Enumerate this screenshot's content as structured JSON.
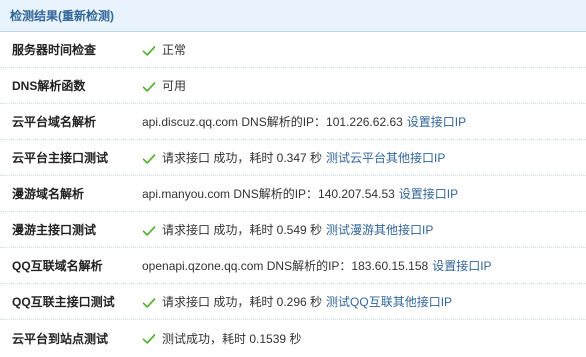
{
  "header": {
    "title": "检测结果(重新检测)"
  },
  "colors": {
    "accent": "#336699",
    "check": "#4caf2a",
    "header_bg": "#e8f3fd"
  },
  "rows": [
    {
      "label": "服务器时间检查",
      "check": true,
      "text": "正常",
      "link": ""
    },
    {
      "label": "DNS解析函数",
      "check": true,
      "text": "可用",
      "link": ""
    },
    {
      "label": "云平台域名解析",
      "check": false,
      "text": "api.discuz.qq.com DNS解析的IP：101.226.62.63",
      "link": "设置接口IP"
    },
    {
      "label": "云平台主接口测试",
      "check": true,
      "text": "请求接口 成功，耗时 0.347 秒",
      "link": "测试云平台其他接口IP"
    },
    {
      "label": "漫游域名解析",
      "check": false,
      "text": "api.manyou.com DNS解析的IP：140.207.54.53",
      "link": "设置接口IP"
    },
    {
      "label": "漫游主接口测试",
      "check": true,
      "text": "请求接口 成功，耗时 0.549 秒",
      "link": "测试漫游其他接口IP"
    },
    {
      "label": "QQ互联域名解析",
      "check": false,
      "text": "openapi.qzone.qq.com DNS解析的IP：183.60.15.158",
      "link": "设置接口IP"
    },
    {
      "label": "QQ互联主接口测试",
      "check": true,
      "text": "请求接口 成功，耗时 0.296 秒",
      "link": "测试QQ互联其他接口IP"
    },
    {
      "label": "云平台到站点测试",
      "check": true,
      "text": "测试成功，耗时 0.1539 秒",
      "link": ""
    }
  ]
}
